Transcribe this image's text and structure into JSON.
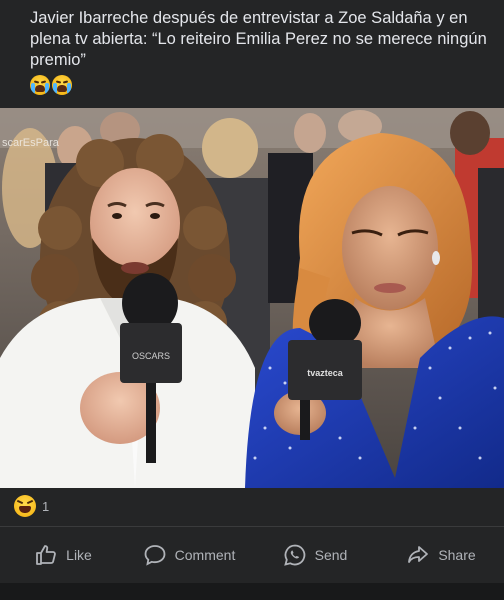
{
  "post": {
    "text": "Javier Ibarreche después de entrevistar a Zoe Saldaña y en plena tv abierta: “Lo reiteiro Emilia Perez no se merece ningún premio”",
    "emojis": [
      "loudly-crying-face-icon",
      "loudly-crying-face-icon"
    ]
  },
  "photo": {
    "background_sign": "scarEsPara",
    "mic_left_logo": "OSCARS",
    "mic_right_logo": "tvazteca"
  },
  "reactions": {
    "icon": "laughing-face-icon",
    "count": "1"
  },
  "actions": {
    "like": "Like",
    "comment": "Comment",
    "send": "Send",
    "share": "Share"
  },
  "colors": {
    "background": "#242526",
    "text": "#e4e6eb",
    "muted": "#b0b3b8",
    "dress_blue": "#1e3aa8"
  }
}
